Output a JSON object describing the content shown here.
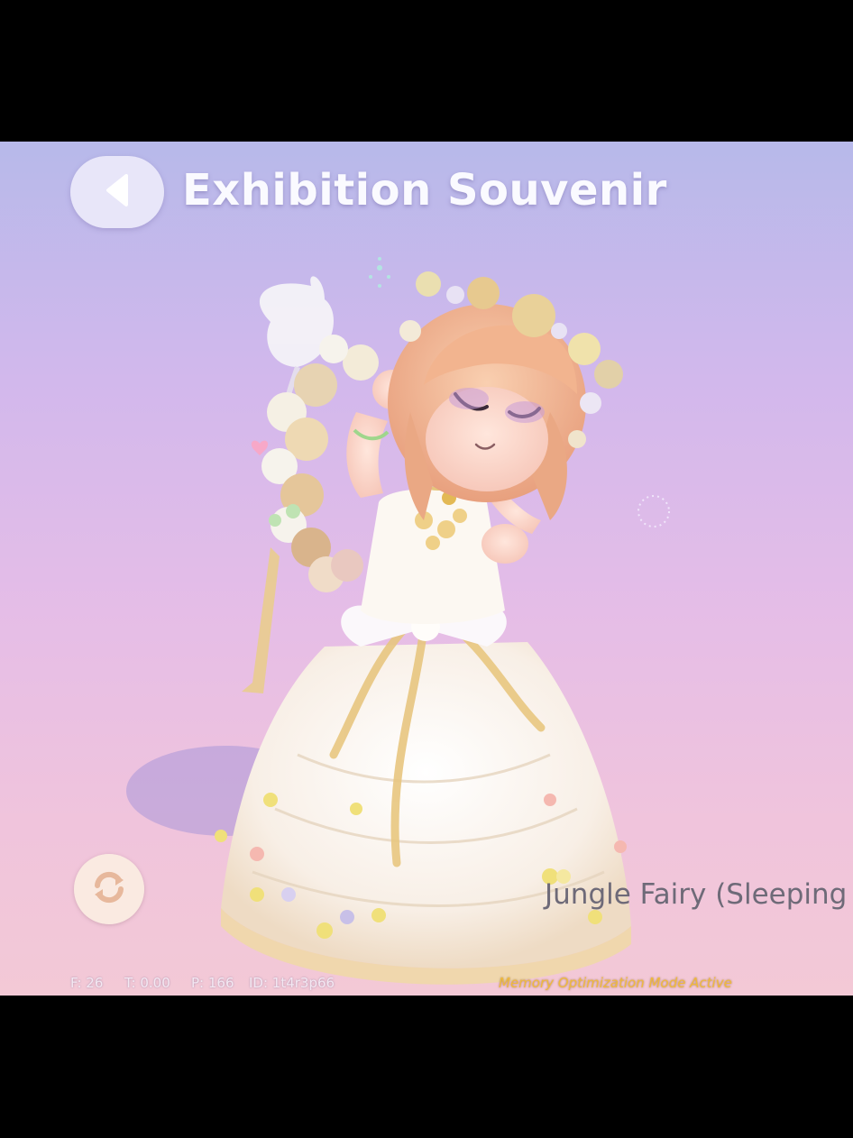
{
  "header": {
    "back_icon": "chevron-left-icon",
    "title": "Exhibition Souvenir"
  },
  "controls": {
    "rotate_icon": "rotate-icon"
  },
  "item": {
    "name": "Jungle Fairy (Sleeping"
  },
  "debug": {
    "f": "F: 26",
    "t": "T: 0.00",
    "p": "P: 166",
    "id": "ID: 1t4r3p66",
    "memory_mode": "Memory Optimization Mode Active"
  },
  "colors": {
    "sky_top": "#b7b9ea",
    "sky_bottom": "#f3c9d6",
    "accent_gold": "#f0b93c",
    "hair": "#f2b08e",
    "dress": "#fbf3ea"
  }
}
